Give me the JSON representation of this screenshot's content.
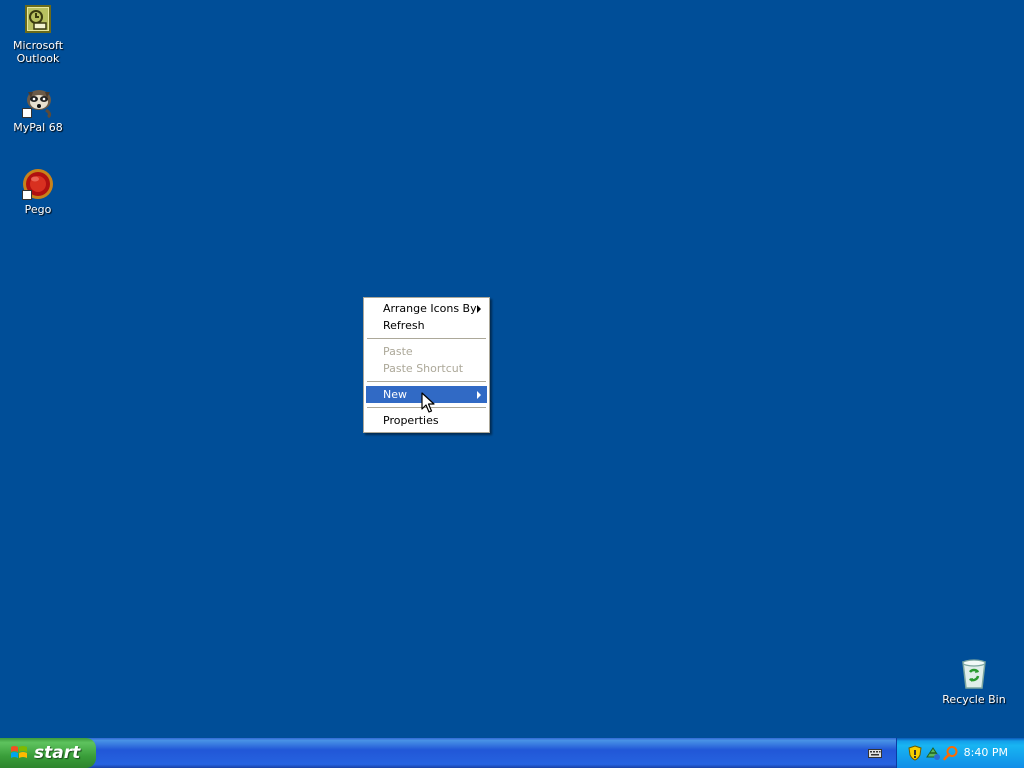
{
  "desktop": {
    "icons": [
      {
        "label": "Microsoft\nOutlook",
        "icon": "outlook-icon"
      },
      {
        "label": "MyPal 68",
        "icon": "mypal-icon"
      },
      {
        "label": "Pego",
        "icon": "pego-icon"
      },
      {
        "label": "Recycle Bin",
        "icon": "recycle-bin-icon"
      }
    ],
    "background_color": "#004E98"
  },
  "context_menu": {
    "items": [
      {
        "label": "Arrange Icons By",
        "submenu": true,
        "enabled": true
      },
      {
        "label": "Refresh",
        "submenu": false,
        "enabled": true
      },
      {
        "label": "Paste",
        "submenu": false,
        "enabled": false
      },
      {
        "label": "Paste Shortcut",
        "submenu": false,
        "enabled": false
      },
      {
        "label": "New",
        "submenu": true,
        "enabled": true,
        "highlighted": true
      },
      {
        "label": "Properties",
        "submenu": false,
        "enabled": true
      }
    ],
    "highlight_color": "#316AC5"
  },
  "taskbar": {
    "start_label": "start",
    "clock": "8:40 PM",
    "tray_icons": [
      "security-shield-icon",
      "network-icon",
      "search-icon"
    ]
  }
}
